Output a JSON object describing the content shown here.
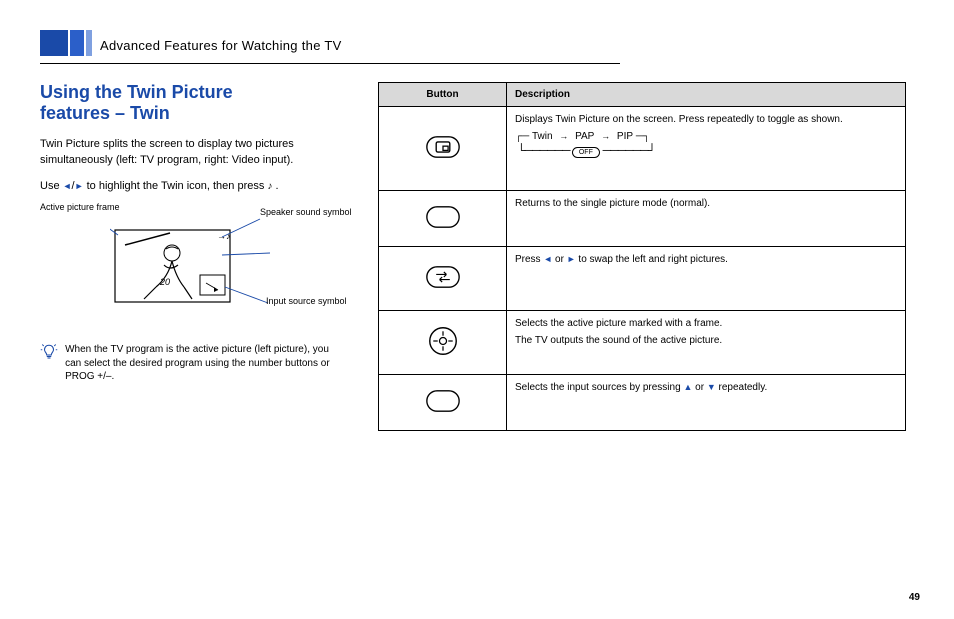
{
  "chapter_title": "Advanced Features for Watching the TV",
  "heading_line1": "Using the Twin Picture",
  "heading_line2": "features – Twin",
  "left": {
    "p1": "Twin Picture splits the screen to display two pictures simultaneously (left: TV program, right: Video input).",
    "p2_prefix": "Use ",
    "p2_mid1": " to highlight the ",
    "p2_feature": "Twin",
    "p2_mid2": " icon, then press ",
    "p2_suffix": ".",
    "callout_active": "Active picture frame",
    "callout_speaker": "Speaker sound symbol",
    "callout_source": "Input source symbol",
    "illus_jersey": "20",
    "tip": "When the TV program is the active picture (left picture), you can select the desired program using the number buttons or PROG +/–."
  },
  "table": {
    "header_left": "Button",
    "header_right": "Description",
    "r1": {
      "desc": "Displays Twin Picture on the screen. Press repeatedly to toggle as shown.",
      "seq_a": "Twin",
      "seq_b": "PAP",
      "seq_c": "PIP",
      "off": "OFF"
    },
    "r2": {
      "desc": "Returns to the single picture mode (normal)."
    },
    "r3": {
      "desc_prefix": "Press ",
      "desc_mid": " or ",
      "desc_suffix": " to swap the left and right pictures."
    },
    "r4": {
      "desc": "Selects the active picture marked with a frame.",
      "desc2": "The TV outputs the sound of the active picture."
    },
    "r5": {
      "desc_prefix": "Selects the input sources by pressing ",
      "desc_mid": " or ",
      "desc_suffix": " repeatedly."
    }
  },
  "page_number": "49"
}
